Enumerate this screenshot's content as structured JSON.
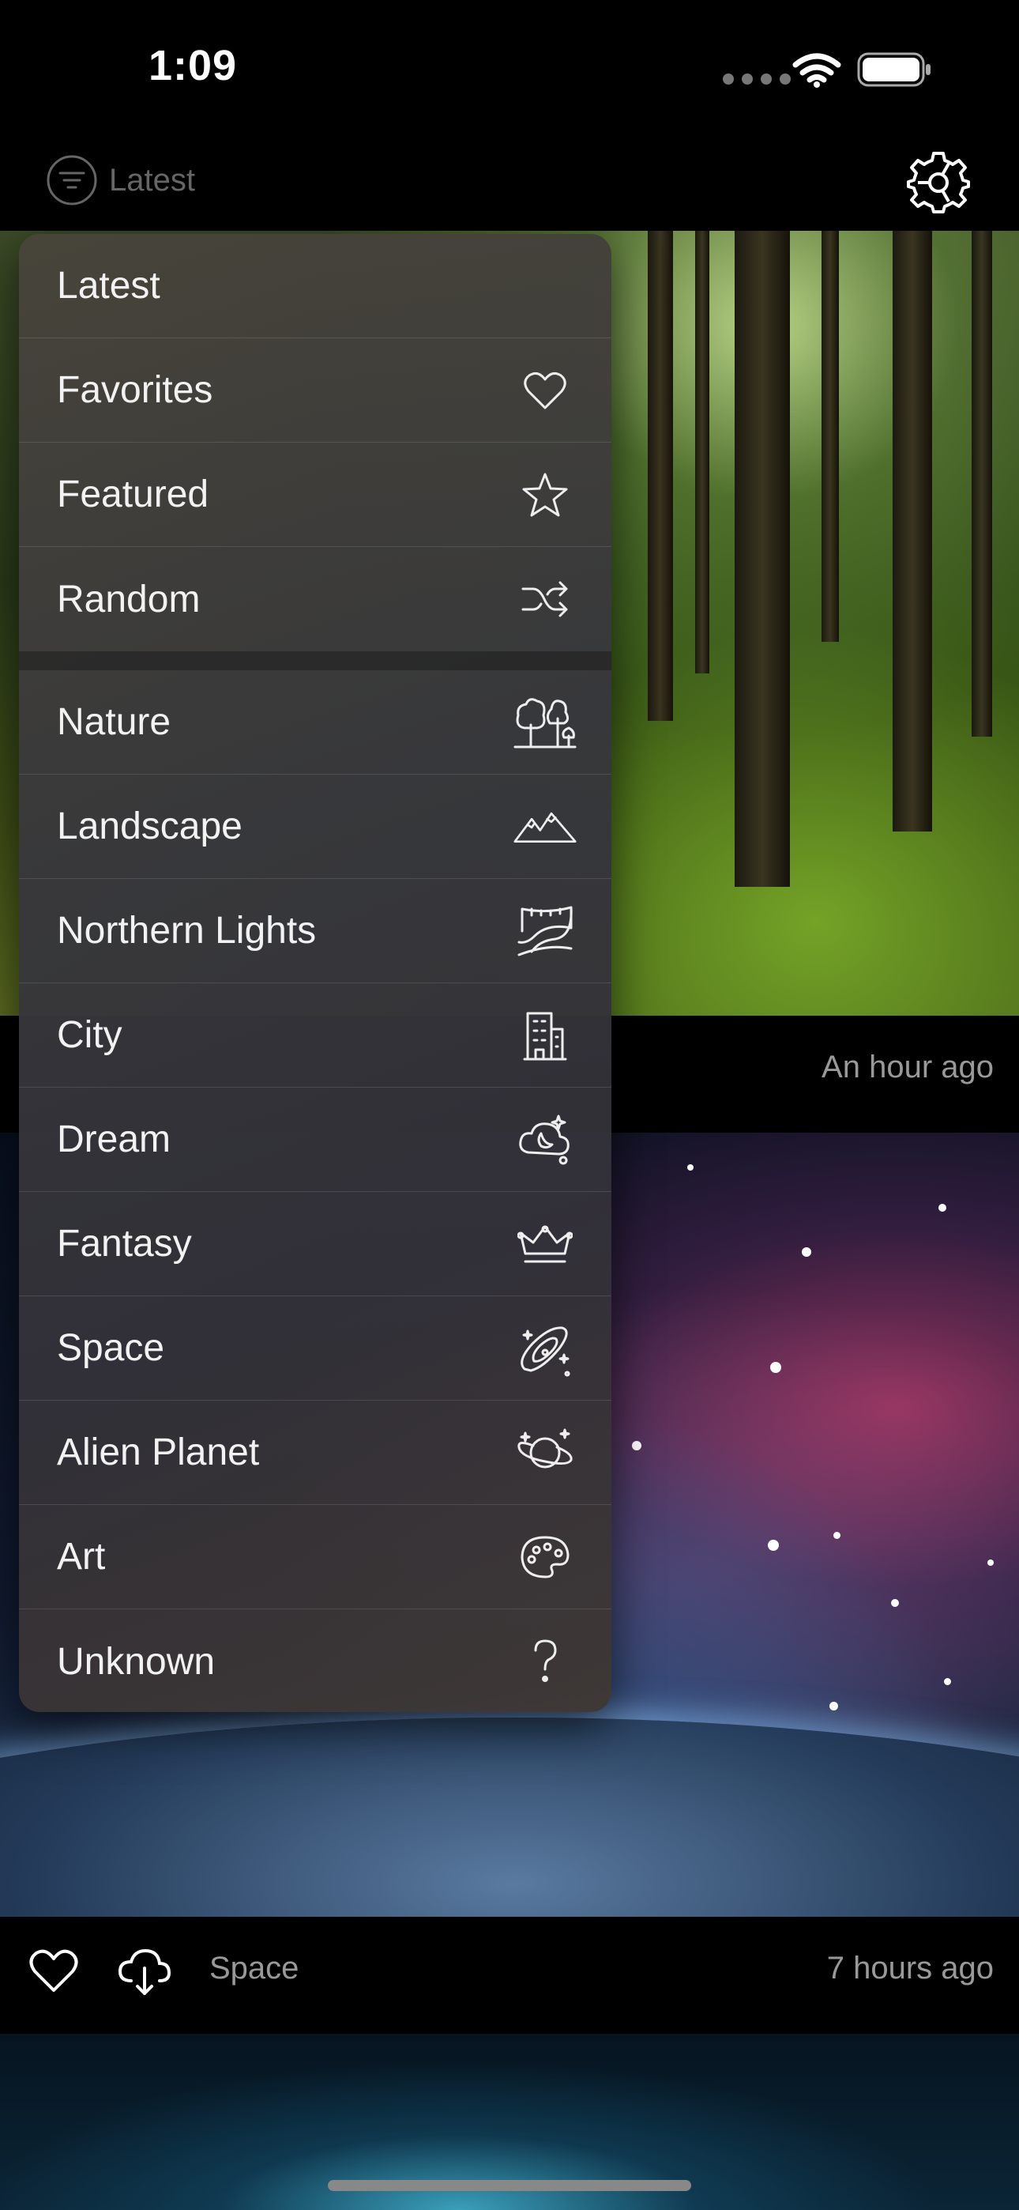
{
  "status_bar": {
    "time": "1:09"
  },
  "nav": {
    "current_filter": "Latest"
  },
  "feed": [
    {
      "timestamp": "An hour ago"
    },
    {
      "category": "Space",
      "timestamp": "7 hours ago"
    }
  ],
  "menu": {
    "items": [
      {
        "label": "Latest",
        "icon": "none"
      },
      {
        "label": "Favorites",
        "icon": "heart-icon"
      },
      {
        "label": "Featured",
        "icon": "star-icon"
      },
      {
        "label": "Random",
        "icon": "shuffle-icon"
      },
      {
        "label": "Nature",
        "icon": "trees-icon"
      },
      {
        "label": "Landscape",
        "icon": "mountains-icon"
      },
      {
        "label": "Northern Lights",
        "icon": "aurora-icon"
      },
      {
        "label": "City",
        "icon": "building-icon"
      },
      {
        "label": "Dream",
        "icon": "moon-cloud-icon"
      },
      {
        "label": "Fantasy",
        "icon": "crown-icon"
      },
      {
        "label": "Space",
        "icon": "galaxy-icon"
      },
      {
        "label": "Alien Planet",
        "icon": "planet-icon"
      },
      {
        "label": "Art",
        "icon": "palette-icon"
      },
      {
        "label": "Unknown",
        "icon": "question-icon"
      }
    ]
  },
  "colors": {
    "background": "#000000",
    "menu_text": "#f2f2f2",
    "secondary_text": "#999999"
  }
}
